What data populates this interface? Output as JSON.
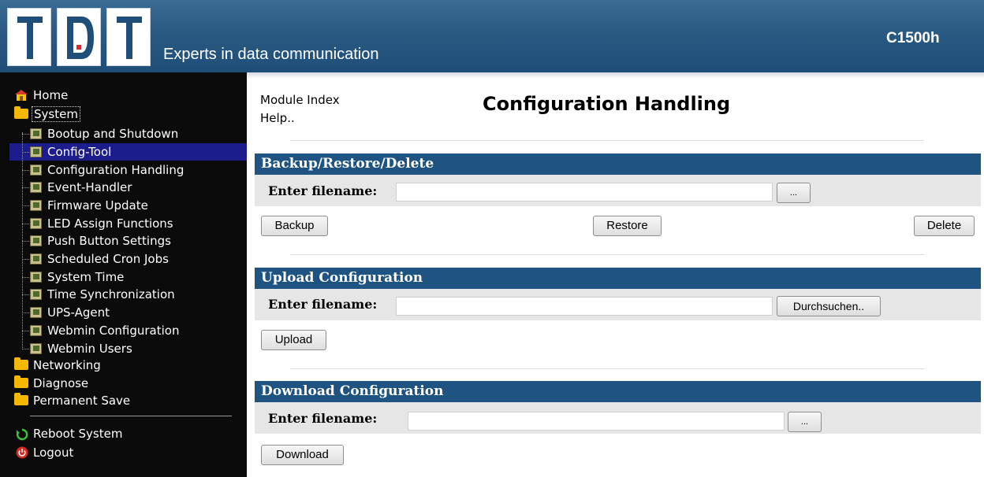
{
  "header": {
    "logo_letters": [
      "T",
      "D",
      "T"
    ],
    "tagline": "Experts in data communication",
    "model": "C1500h",
    "colors": {
      "header_bg": "#2a5a82",
      "logo_blue": "#1f4e78"
    }
  },
  "sidebar": {
    "items": [
      {
        "label": "Home",
        "icon": "home-icon"
      },
      {
        "label": "System",
        "icon": "folder-open-icon"
      },
      {
        "label": "Bootup and Shutdown",
        "icon": "module-icon"
      },
      {
        "label": "Config-Tool",
        "icon": "module-icon",
        "selected": true
      },
      {
        "label": "Configuration Handling",
        "icon": "module-icon"
      },
      {
        "label": "Event-Handler",
        "icon": "module-icon"
      },
      {
        "label": "Firmware Update",
        "icon": "module-icon"
      },
      {
        "label": "LED Assign Functions",
        "icon": "module-icon"
      },
      {
        "label": "Push Button Settings",
        "icon": "module-icon"
      },
      {
        "label": "Scheduled Cron Jobs",
        "icon": "module-icon"
      },
      {
        "label": "System Time",
        "icon": "module-icon"
      },
      {
        "label": "Time Synchronization",
        "icon": "module-icon"
      },
      {
        "label": "UPS-Agent",
        "icon": "module-icon"
      },
      {
        "label": "Webmin Configuration",
        "icon": "module-icon"
      },
      {
        "label": "Webmin Users",
        "icon": "module-icon"
      },
      {
        "label": "Networking",
        "icon": "folder-icon"
      },
      {
        "label": "Diagnose",
        "icon": "folder-icon"
      },
      {
        "label": "Permanent Save",
        "icon": "folder-icon"
      }
    ],
    "reboot": "Reboot System",
    "logout": "Logout",
    "colors": {
      "bg": "#0b0b0b",
      "selected": "#1c1c8c"
    }
  },
  "main": {
    "links": {
      "module_index": "Module Index",
      "help": "Help.."
    },
    "title": "Configuration Handling",
    "backup": {
      "header": "Backup/Restore/Delete",
      "label": "Enter filename:",
      "value": "",
      "browse": "...",
      "backup_btn": "Backup",
      "restore_btn": "Restore",
      "delete_btn": "Delete"
    },
    "upload": {
      "header": "Upload Configuration",
      "label": "Enter filename:",
      "value": "",
      "browse": "Durchsuchen..",
      "upload_btn": "Upload"
    },
    "download": {
      "header": "Download Configuration",
      "label": "Enter filename:",
      "value": "",
      "browse": "...",
      "download_btn": "Download"
    },
    "colors": {
      "section_header": "#1f5381",
      "row_bg": "#e6e6e6"
    }
  }
}
